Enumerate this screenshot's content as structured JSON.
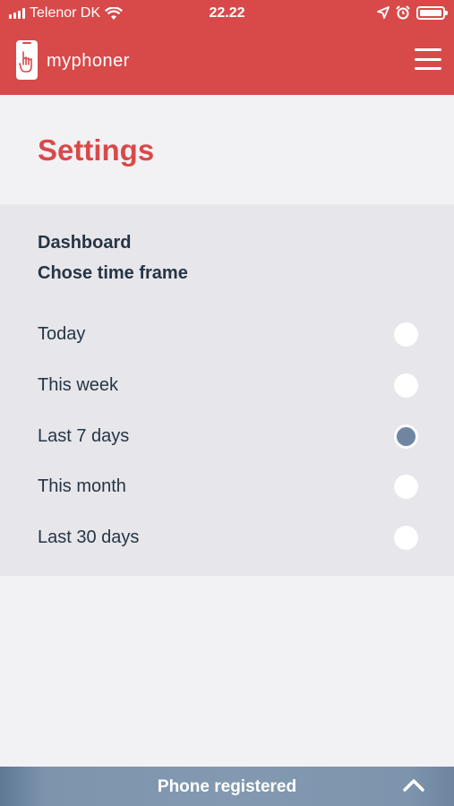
{
  "status_bar": {
    "carrier": "Telenor DK",
    "time": "22.22"
  },
  "app_bar": {
    "brand": "myphoner"
  },
  "page": {
    "title": "Settings"
  },
  "dashboard": {
    "heading": "Dashboard",
    "subheading": "Chose time frame",
    "options": [
      {
        "label": "Today",
        "selected": false
      },
      {
        "label": "This week",
        "selected": false
      },
      {
        "label": "Last 7 days",
        "selected": true
      },
      {
        "label": "This month",
        "selected": false
      },
      {
        "label": "Last 30 days",
        "selected": false
      }
    ]
  },
  "bottom_bar": {
    "label": "Phone registered"
  },
  "colors": {
    "brand_red": "#d84a4a",
    "text_dark": "#263544",
    "radio_selected": "#6f86a1",
    "bottom_bar": "#8299b1"
  },
  "icons": [
    "signal-icon",
    "wifi-icon",
    "location-icon",
    "alarm-icon",
    "battery-icon",
    "phone-logo-icon",
    "hamburger-menu-icon",
    "chevron-up-icon"
  ]
}
